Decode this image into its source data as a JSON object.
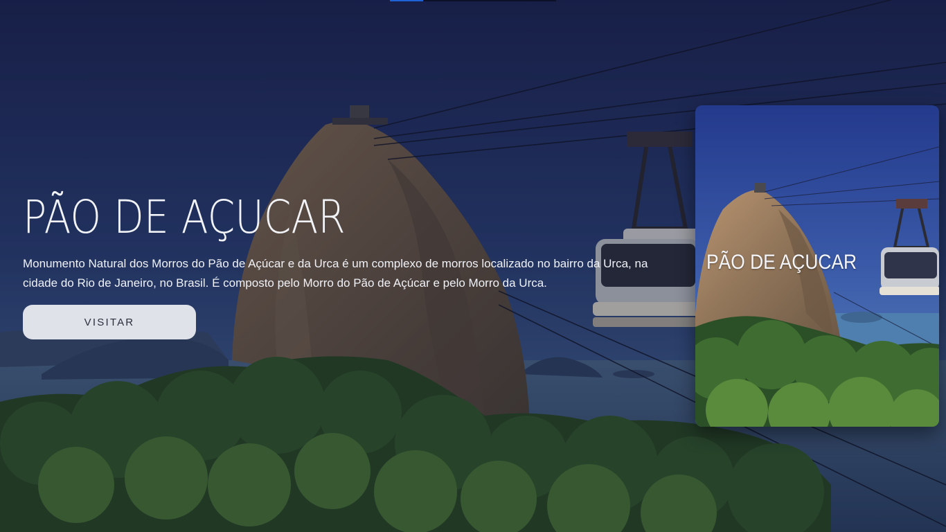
{
  "slider": {
    "progress": 0.2
  },
  "hero": {
    "title": "PÃO DE AÇUCAR",
    "description": "Monumento Natural dos Morros do Pão de Açúcar e da Urca é um complexo de morros localizado no bairro da Urca, na cidade do Rio de Janeiro, no Brasil. É composto pelo Morro do Pão de Açúcar e pelo Morro da Urca.",
    "button_label": "VISITAR"
  },
  "card": {
    "title": "PÃO DE AÇUCAR"
  },
  "colors": {
    "accent": "#1e63d6",
    "sky_top": "#1b2550",
    "button_bg": "#ecedf2"
  }
}
